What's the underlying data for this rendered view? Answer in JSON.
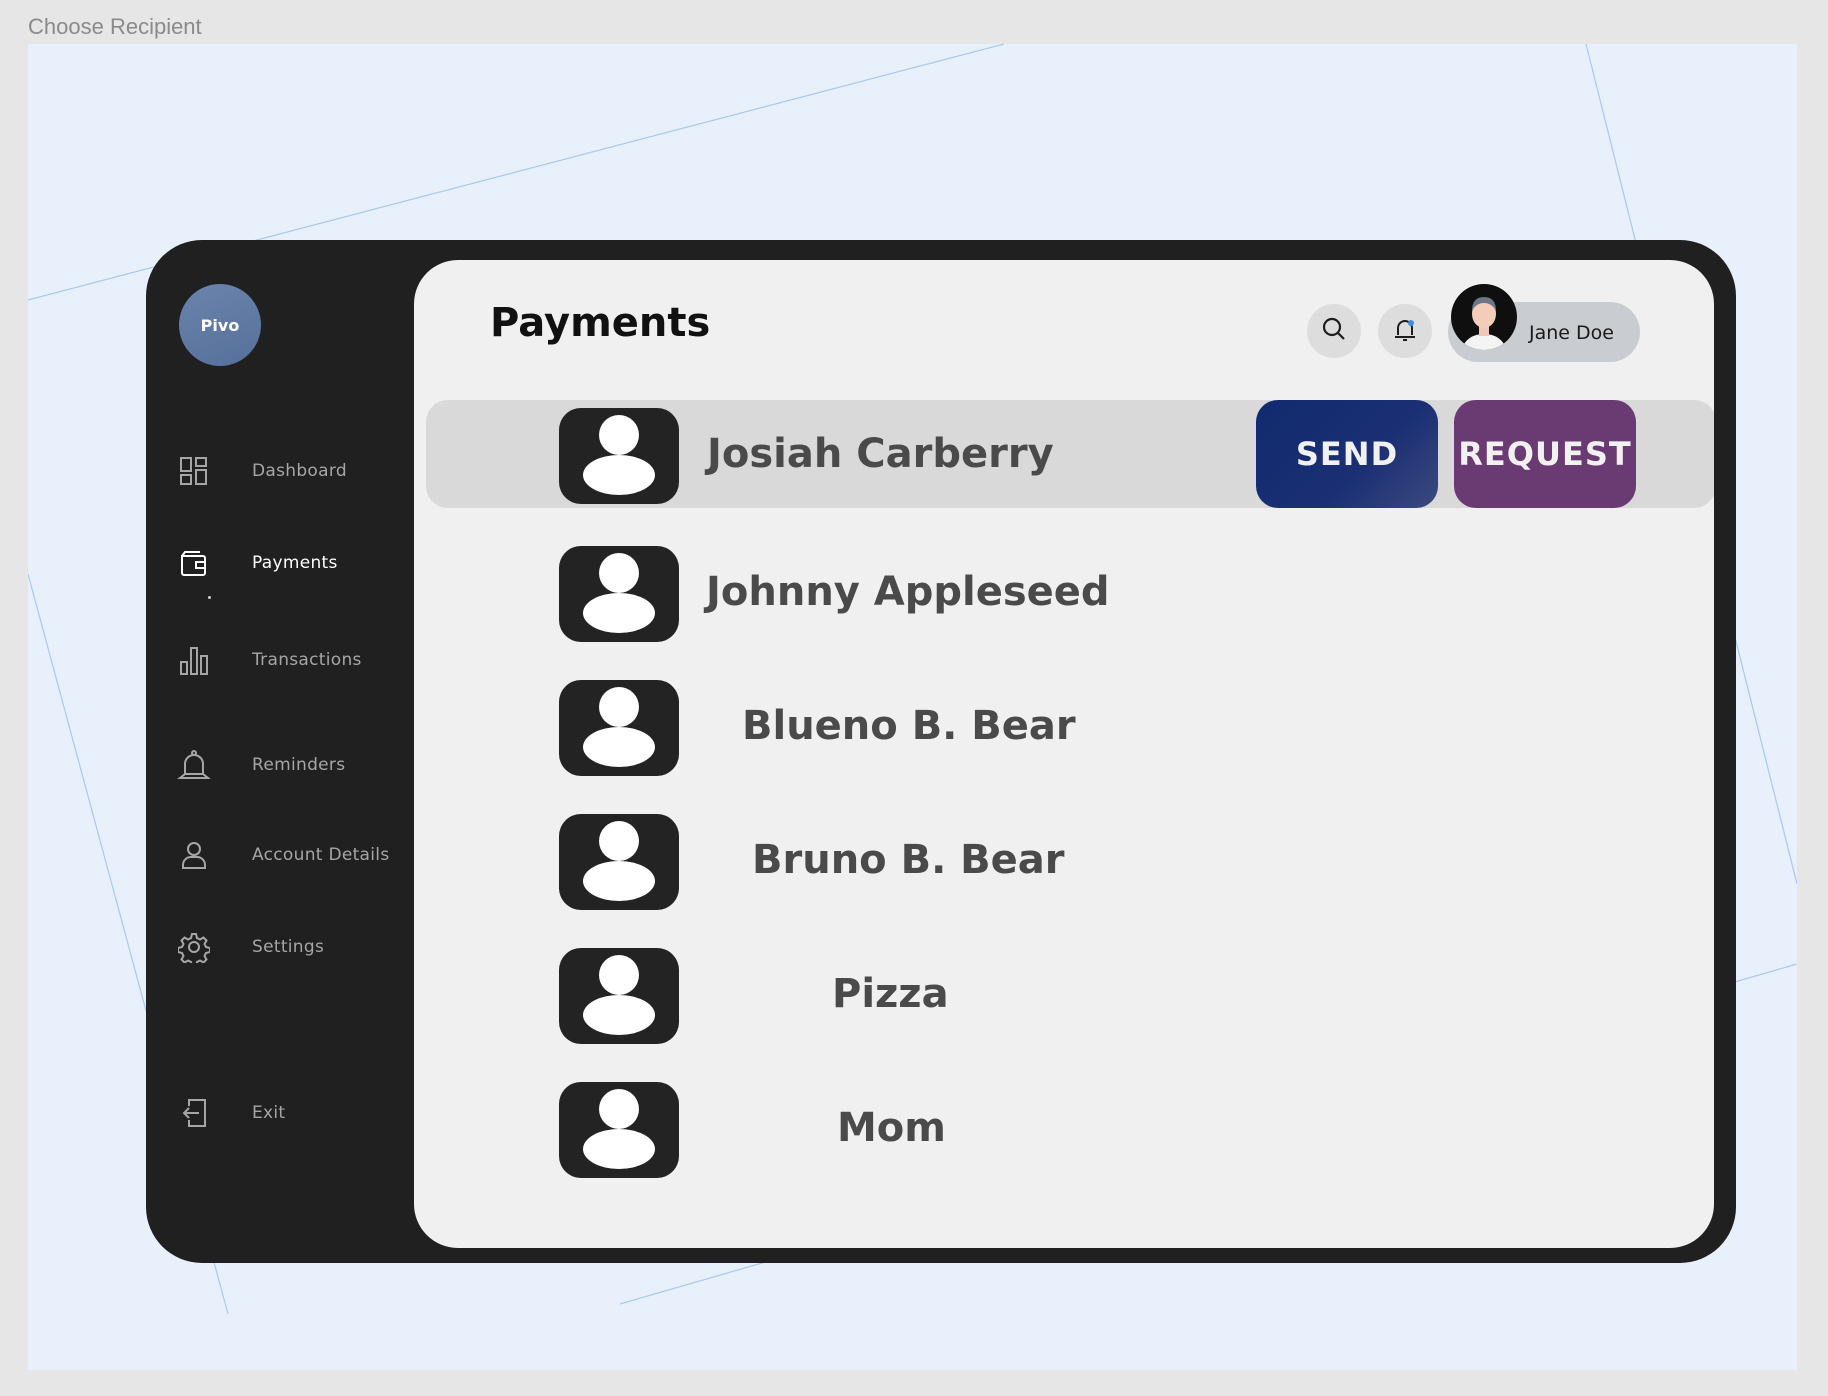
{
  "frame": {
    "label": "Choose Recipient"
  },
  "app": {
    "logo_text": "Pivo"
  },
  "sidebar": {
    "items": [
      {
        "label": "Dashboard",
        "icon": "dashboard-grid-icon"
      },
      {
        "label": "Payments",
        "icon": "wallet-icon",
        "active": true
      },
      {
        "label": "Transactions",
        "icon": "bar-chart-icon"
      },
      {
        "label": "Reminders",
        "icon": "bell-icon"
      },
      {
        "label": "Account Details",
        "icon": "user-icon"
      },
      {
        "label": "Settings",
        "icon": "gear-icon"
      },
      {
        "label": "Exit",
        "icon": "exit-icon"
      }
    ]
  },
  "header": {
    "title": "Payments",
    "search_icon": "search-icon",
    "notification_icon": "bell-notification-icon",
    "user": {
      "name": "Jane Doe"
    }
  },
  "recipients": [
    {
      "name": "Josiah Carberry",
      "selected": true
    },
    {
      "name": "Johnny Appleseed"
    },
    {
      "name": "Blueno B. Bear"
    },
    {
      "name": "Bruno B. Bear"
    },
    {
      "name": "Pizza"
    },
    {
      "name": "Mom"
    }
  ],
  "actions": {
    "send_label": "SEND",
    "request_label": "REQUEST"
  },
  "colors": {
    "send": "#13296e",
    "request": "#6a3a72",
    "device": "#202020",
    "panel": "#f0f0f0",
    "canvas": "#e8f1fb"
  }
}
